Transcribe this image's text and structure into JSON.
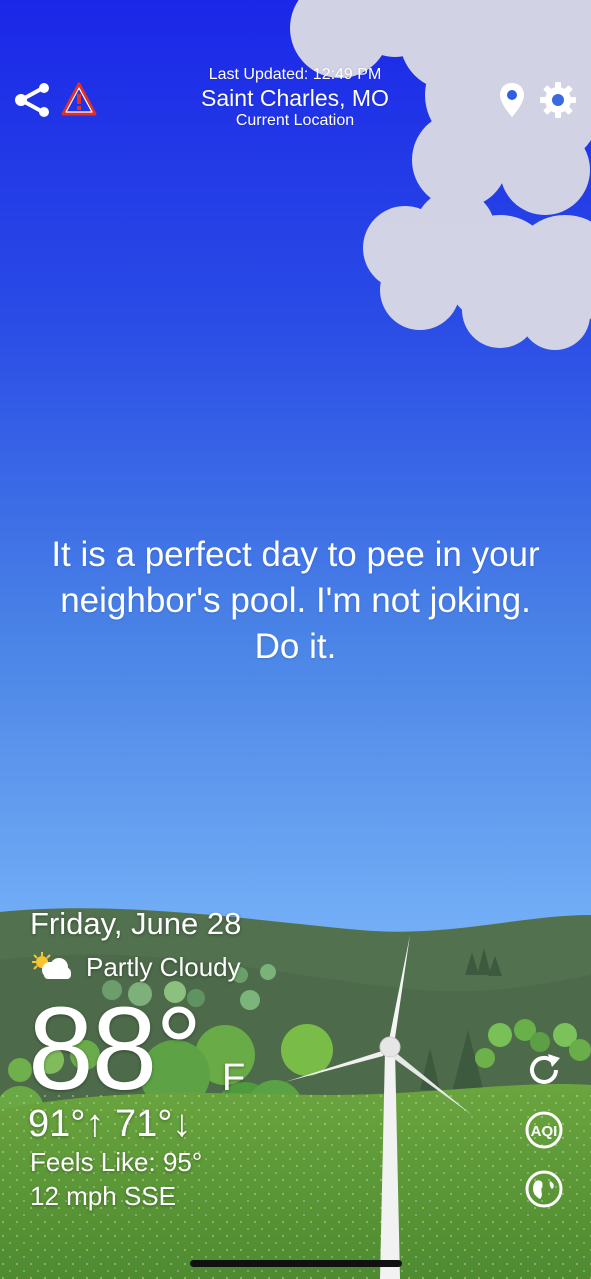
{
  "header": {
    "last_updated": "Last Updated: 12:49 PM",
    "city": "Saint Charles, MO",
    "location_label": "Current Location"
  },
  "message": "It is a perfect day to pee in your neighbor's pool. I'm not joking. Do it.",
  "weather": {
    "date": "Friday, June 28",
    "condition": "Partly Cloudy",
    "temperature": "88°",
    "unit": "F",
    "hi_lo": "91°↑  71°↓",
    "feels_like": "Feels Like: 95°",
    "wind": "12 mph SSE"
  },
  "icons": {
    "share": "share-icon",
    "alert": "warning-triangle-icon",
    "location": "map-pin-icon",
    "settings": "gear-icon",
    "refresh": "refresh-icon",
    "aqi": "aqi-icon",
    "radar": "radar-globe-icon",
    "condition": "partly-cloudy-icon",
    "aqi_label": "AQI"
  },
  "colors": {
    "sky_top": "#1d2ee6",
    "sky_mid": "#3f79e6",
    "sky_bottom": "#7ab4f6",
    "hill_dark": "#4f6d4f",
    "grass": "#5f9a3a",
    "alert_red": "#e0302a"
  }
}
